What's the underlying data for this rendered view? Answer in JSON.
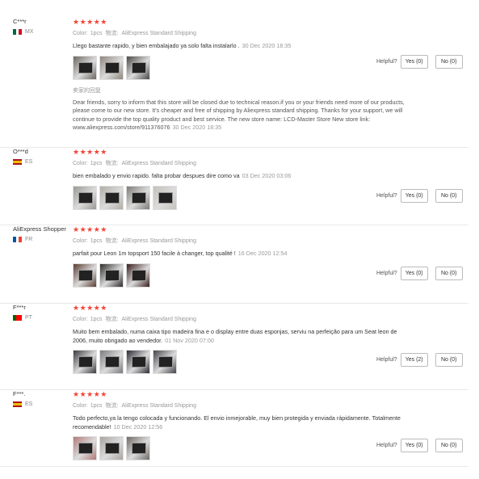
{
  "helpful_label": "Helpful?",
  "stars": "★★★★★",
  "reviews": [
    {
      "user": "C***r",
      "country": "MX",
      "flag": [
        "#006847",
        "#ffffff",
        "#ce1126"
      ],
      "color_label": "Color:",
      "color_value": "1pcs",
      "logistics_label": "物流:",
      "logistics_value": "AliExpress Standard Shipping",
      "feedback": "Llego bastante rapido, y bien embalajado ya solo falta instalarlo .",
      "date": "30 Dec 2020 18:35",
      "photos": [
        "#6b6660",
        "#8e857c",
        "#4a4746"
      ],
      "reply_title": "卖家的回复",
      "reply_text": "Dear friends, sorry to inform that this store will be closed due to technical reason.if you or your friends need more of our products, please come to our new store. It's cheaper and free of shipping by Aliexpress standard shipping. Thanks for your support, we will continue to provide the top quality product and best service. The new store name: LCD-Master Store New store link: www.aliexpress.com/store/911376076",
      "reply_date": "30 Dec 2020 18:35",
      "yes": "Yes (0)",
      "no": "No (0)"
    },
    {
      "user": "O***d",
      "country": "ES",
      "flag": [
        "#aa151b",
        "#f1bf00",
        "#aa151b"
      ],
      "color_label": "Color:",
      "color_value": "1pcs",
      "logistics_label": "物流:",
      "logistics_value": "AliExpress Standard Shipping",
      "feedback": "bien embalado y envio rapido. falta probar despues dire como va",
      "date": "03 Dec 2020 03:06",
      "photos": [
        "#9a9894",
        "#b0aca6",
        "#7d7a76",
        "#c4c1bb"
      ],
      "yes": "Yes (0)",
      "no": "No (0)"
    },
    {
      "user": "AliExpress Shopper",
      "country": "FR",
      "flag": [
        "#0055a4",
        "#ffffff",
        "#ef4135"
      ],
      "color_label": "Color:",
      "color_value": "1pcs",
      "logistics_label": "物流:",
      "logistics_value": "AliExpress Standard Shipping",
      "feedback": "parfait pour Leon 1m topsport 150 facile à changer, top qualité !",
      "date": "16 Dec 2020 12:54",
      "photos": [
        "#5a3d32",
        "#2e2b2a",
        "#3a1d1d"
      ],
      "yes": "Yes (0)",
      "no": "No (0)"
    },
    {
      "user": "F***r",
      "country": "PT",
      "flag": [
        "#006600",
        "#ff0000",
        "#ff0000"
      ],
      "color_label": "Color:",
      "color_value": "1pcs",
      "logistics_label": "物流:",
      "logistics_value": "AliExpress Standard Shipping",
      "feedback": "Muito bem embalado, numa caixa tipo madeira fina e o display entre duas esponjas, serviu na perfeição para um Seat leon de 2006, muito obrigado ao vendedor.",
      "date": "01 Nov 2020 07:00",
      "photos": [
        "#3b3b3f",
        "#7b7a7e",
        "#2b2c33",
        "#44434a"
      ],
      "yes": "Yes (2)",
      "no": "No (0)"
    },
    {
      "user": "F***.",
      "country": "ES",
      "flag": [
        "#aa151b",
        "#f1bf00",
        "#aa151b"
      ],
      "color_label": "Color:",
      "color_value": "1pcs",
      "logistics_label": "物流:",
      "logistics_value": "AliExpress Standard Shipping",
      "feedback": "Todo perfecto,ya la tengo colocada y funcionando. El envio inmejorable, muy bien protegida y enviada rápidamente. Totalmente recomendable!",
      "date": "10 Dec 2020 12:56",
      "photos": [
        "#b07a78",
        "#a8a4a0",
        "#6f6a66"
      ],
      "yes": "Yes (0)",
      "no": "No (0)"
    }
  ]
}
